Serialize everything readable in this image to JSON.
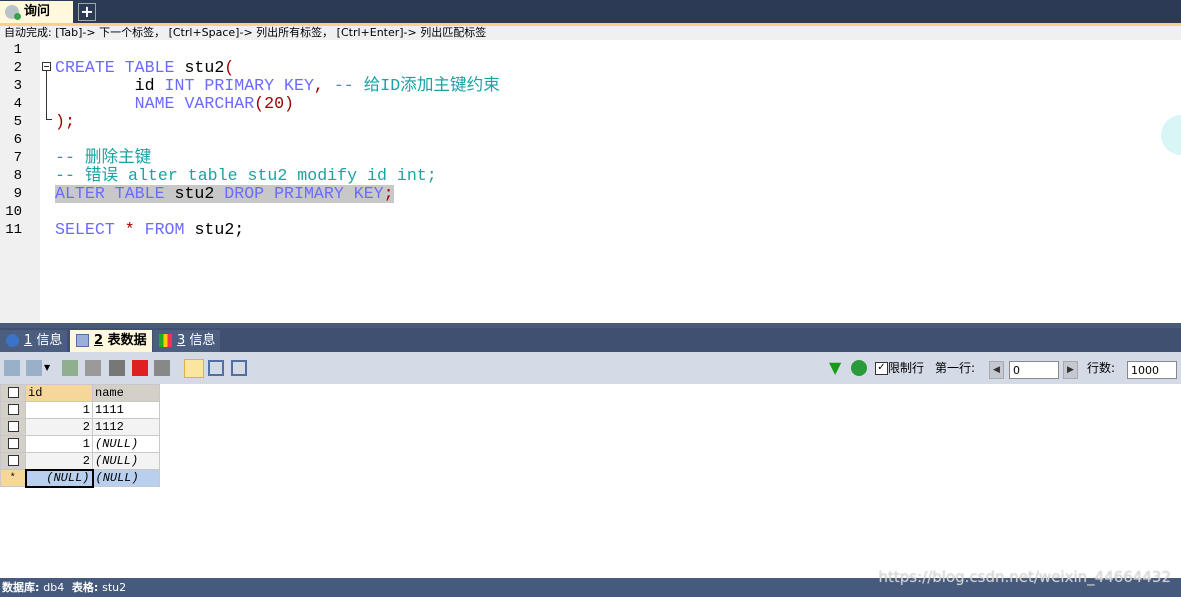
{
  "query_tab": {
    "label": "询问",
    "icon": "query-icon"
  },
  "new_tab_icon": "plus-icon",
  "hint": "自动完成: [Tab]-> 下一个标签， [Ctrl+Space]-> 列出所有标签， [Ctrl+Enter]-> 列出匹配标签",
  "line_numbers": [
    "1",
    "2",
    "3",
    "4",
    "5",
    "6",
    "7",
    "8",
    "9",
    "10",
    "11"
  ],
  "code": {
    "l2a": "CREATE TABLE",
    "l2b": " stu2",
    "l3a": "        id ",
    "l3b": "INT PRIMARY KEY",
    "l3c": ", ",
    "l3d": "-- 给ID添加主键约束",
    "l4a": "        ",
    "l4b": "NAME VARCHAR",
    "l4c": "(20)",
    "l5": ");",
    "l7": "-- 删除主键",
    "l8": "-- 错误 alter table stu2 modify id int;",
    "l9a": "ALTER TABLE",
    "l9b": " stu2 ",
    "l9c": "DROP PRIMARY KEY",
    "l11a": "SELECT ",
    "l11b": "*",
    "l11c": " FROM",
    "l11d": " stu2;"
  },
  "bottom_tabs": [
    {
      "num": "1",
      "label": " 信息",
      "icon": "info-icon"
    },
    {
      "num": "2",
      "label": " 表数据",
      "icon": "table-icon",
      "active": true
    },
    {
      "num": "3",
      "label": " 信息",
      "icon": "chart-icon"
    }
  ],
  "toolbar": {
    "limit_label": "限制行",
    "first_row_label": "第一行:",
    "first_row_value": "0",
    "rows_label": "行数:",
    "rows_value": "1000",
    "limit_checked": true
  },
  "grid": {
    "columns": [
      "id",
      "name"
    ],
    "rows": [
      [
        "1",
        "1111"
      ],
      [
        "2",
        "1112"
      ],
      [
        "1",
        "(NULL)"
      ],
      [
        "2",
        "(NULL)"
      ]
    ],
    "new_row": {
      "marker": "*",
      "id": "(NULL)",
      "name": "(NULL)"
    }
  },
  "status": {
    "db_label": "数据库:",
    "db": "db4",
    "table_label": "表格:",
    "table": "stu2"
  },
  "watermark": "https://blog.csdn.net/weixin_44664432"
}
